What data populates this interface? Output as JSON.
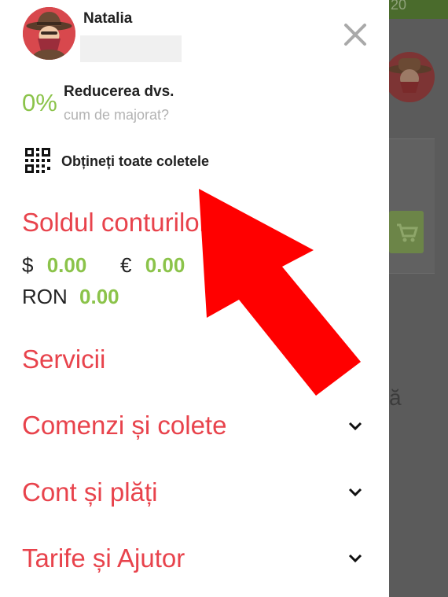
{
  "user": {
    "name": "Natalia"
  },
  "discount": {
    "value": "0%",
    "title": "Reducerea dvs.",
    "subtitle": "cum de majorat?"
  },
  "parcels_link": "Obțineți toate coletele",
  "balance": {
    "title": "Soldul conturilor",
    "usd": {
      "symbol": "$",
      "amount": "0.00"
    },
    "eur": {
      "symbol": "€",
      "amount": "0.00"
    },
    "ron": {
      "symbol": "RON",
      "amount": "0.00"
    }
  },
  "menu": {
    "services": "Servicii",
    "orders": "Comenzi și colete",
    "account": "Cont și plăți",
    "tariffs": "Tarife și Ajutor"
  },
  "background": {
    "status_text": "20",
    "glyph": "ă"
  },
  "colors": {
    "accent_red": "#e8434c",
    "accent_green": "#8bc34a",
    "overlay_gray": "#5b5b5b",
    "arrow_red": "#ff0000"
  }
}
